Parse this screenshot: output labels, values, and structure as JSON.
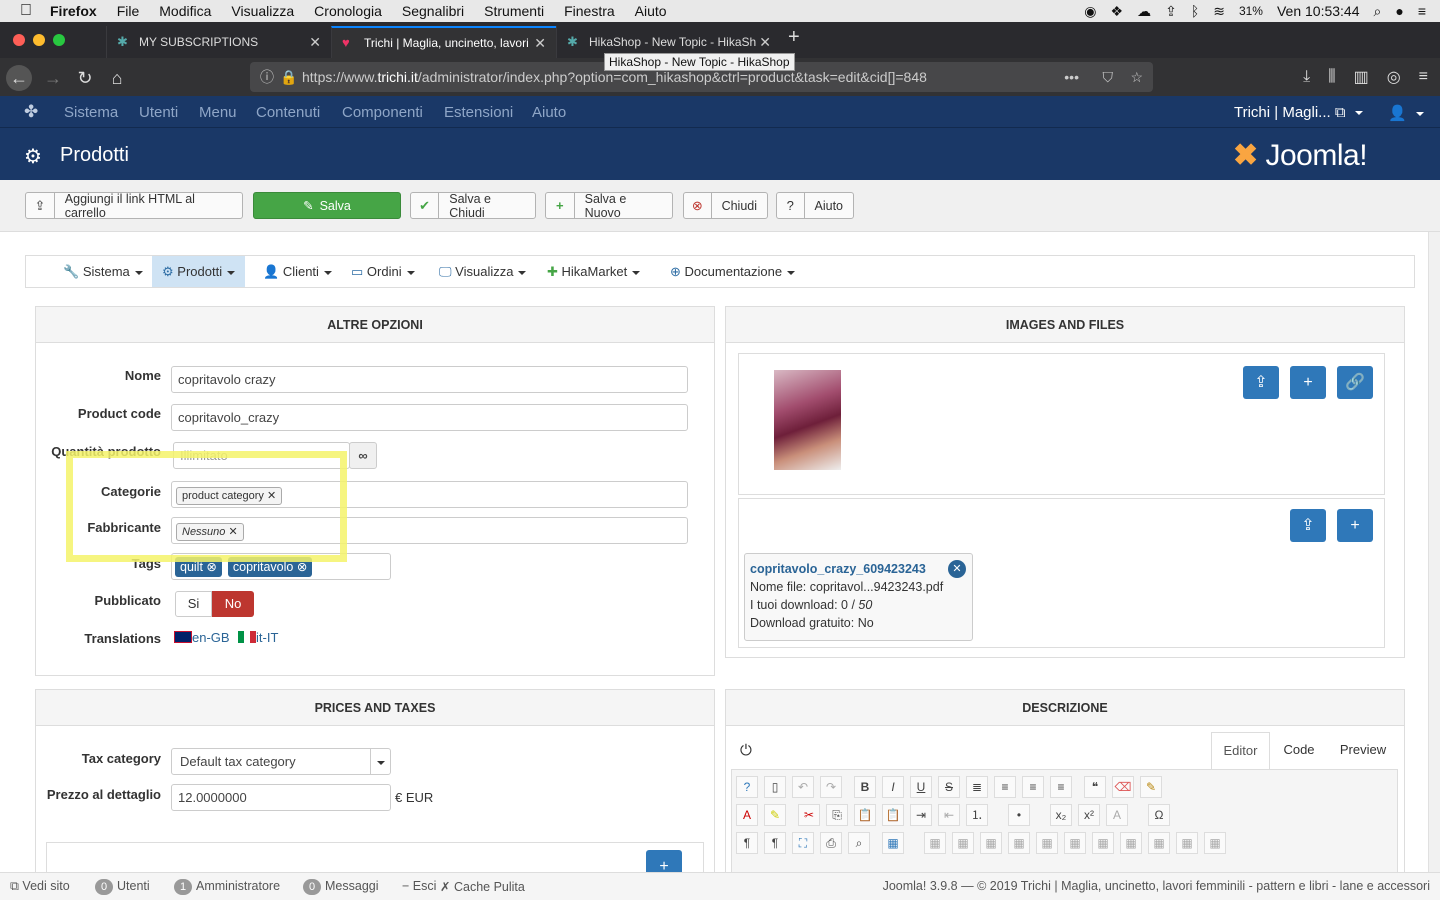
{
  "mac_menu": {
    "app": "Firefox",
    "items": [
      "File",
      "Modifica",
      "Visualizza",
      "Cronologia",
      "Segnalibri",
      "Strumenti",
      "Finestra",
      "Aiuto"
    ],
    "battery": "31%",
    "clock": "Ven 10:53:44"
  },
  "browser": {
    "tabs": [
      {
        "title": "MY SUBSCRIPTIONS"
      },
      {
        "title": "Trichi | Maglia, uncinetto, lavori"
      },
      {
        "title": "HikaShop - New Topic - HikaSh"
      }
    ],
    "url_prefix": "https://www.",
    "url_domain": "trichi.it",
    "url_path": "/administrator/index.php?option=com_hikashop&ctrl=product&task=edit&cid[]=848",
    "tooltip": "HikaShop - New Topic - HikaShop"
  },
  "joomla_nav": {
    "items": [
      "Sistema",
      "Utenti",
      "Menu",
      "Contenuti",
      "Componenti",
      "Estensioni",
      "Aiuto"
    ],
    "site_link": "Trichi | Magli...",
    "brand": "Joomla!"
  },
  "page_title": "Prodotti",
  "toolbar": {
    "add_html_link": "Aggiungi il link HTML al carrello",
    "save": "Salva",
    "save_close": "Salva e Chiudi",
    "save_new": "Salva e Nuovo",
    "close": "Chiudi",
    "help": "Aiuto"
  },
  "hika_menu": [
    "Sistema",
    "Prodotti",
    "Clienti",
    "Ordini",
    "Visualizza",
    "HikaMarket",
    "Documentazione"
  ],
  "altre_opzioni": {
    "title": "ALTRE OPZIONI",
    "nome_label": "Nome",
    "nome_value": "copritavolo crazy",
    "code_label": "Product code",
    "code_value": "copritavolo_crazy",
    "qty_label": "Quantità prodotto",
    "qty_placeholder": "Illimitato",
    "cat_label": "Categorie",
    "cat_chip": "product category",
    "fab_label": "Fabbricante",
    "fab_chip": "Nessuno",
    "tags_label": "Tags",
    "tags": [
      "quilt",
      "copritavolo"
    ],
    "pub_label": "Pubblicato",
    "pub_yes": "Si",
    "pub_no": "No",
    "trans_label": "Translations",
    "trans": [
      "en-GB",
      "it-IT"
    ]
  },
  "images_files": {
    "title": "IMAGES AND FILES",
    "file_name": "copritavolo_crazy_609423243",
    "file_line1": "Nome file: copritavol...9423243.pdf",
    "file_line2_prefix": "I tuoi download: 0 / ",
    "file_line2_max": "50",
    "file_line3": "Download gratuito: No"
  },
  "prices": {
    "title": "PRICES AND TAXES",
    "tax_label": "Tax category",
    "tax_value": "Default tax category",
    "price_label": "Prezzo al dettaglio",
    "price_value": "12.0000000",
    "currency": "€ EUR"
  },
  "descrizione": {
    "title": "DESCRIZIONE",
    "tabs": [
      "Editor",
      "Code",
      "Preview"
    ]
  },
  "status": {
    "view_site": "Vedi sito",
    "users_count": "0",
    "users": "Utenti",
    "admins_count": "1",
    "admins": "Amministratore",
    "msg_count": "0",
    "messages": "Messaggi",
    "logout": "Esci",
    "cache": "Cache Pulita",
    "footer": "Joomla! 3.9.8  —  © 2019 Trichi | Maglia, uncinetto, lavori femminili - pattern e libri - lane e accessori"
  },
  "colors": {
    "joomla_blue": "#1a3867",
    "save_green": "#46a546",
    "highlight": "#f4f36a",
    "button_blue": "#2f78b9",
    "publish_no_red": "#bd362f"
  }
}
